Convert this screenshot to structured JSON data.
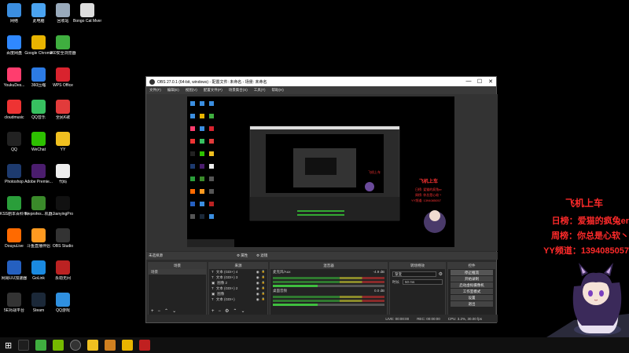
{
  "desktop": {
    "icons": [
      {
        "label": "网络",
        "color": "#3b8ee0",
        "col": 0,
        "row": 0
      },
      {
        "label": "此电脑",
        "color": "#4aa3f0",
        "col": 1,
        "row": 0
      },
      {
        "label": "回收站",
        "color": "#9ab",
        "col": 2,
        "row": 0
      },
      {
        "label": "Bongo Cat Mver",
        "color": "#ddd",
        "col": 3,
        "row": 0
      },
      {
        "label": "百度网盘",
        "color": "#2f88ff",
        "col": 0,
        "row": 1
      },
      {
        "label": "Google Chrome",
        "color": "#e8b400",
        "col": 1,
        "row": 1
      },
      {
        "label": "360安全浏览器",
        "color": "#3fae3f",
        "col": 2,
        "row": 1
      },
      {
        "label": "YoukuDes...",
        "color": "#ff3d6e",
        "col": 0,
        "row": 2
      },
      {
        "label": "360压缩",
        "color": "#2c7be5",
        "col": 1,
        "row": 2
      },
      {
        "label": "WPS Office",
        "color": "#d9232e",
        "col": 2,
        "row": 2
      },
      {
        "label": "cloudmusic",
        "color": "#e33",
        "col": 0,
        "row": 3
      },
      {
        "label": "QQ音乐",
        "color": "#37c060",
        "col": 1,
        "row": 3
      },
      {
        "label": "全民K歌",
        "color": "#e23b3b",
        "col": 2,
        "row": 3
      },
      {
        "label": "QQ",
        "color": "#222",
        "col": 0,
        "row": 4
      },
      {
        "label": "WeChat",
        "color": "#2dc100",
        "col": 1,
        "row": 4
      },
      {
        "label": "YY",
        "color": "#f0c020",
        "col": 2,
        "row": 4
      },
      {
        "label": "Photoshop",
        "color": "#1d3a6e",
        "col": 0,
        "row": 5
      },
      {
        "label": "Adobe Premie...",
        "color": "#4b1d6e",
        "col": 1,
        "row": 5
      },
      {
        "label": "代码",
        "color": "#eee",
        "col": 2,
        "row": 5
      },
      {
        "label": "KSS剧本百科卡拉OK",
        "color": "#2a9e3a",
        "col": 0,
        "row": 6
      },
      {
        "label": "liveprofes...机器",
        "color": "#3a8a2a",
        "col": 1,
        "row": 6
      },
      {
        "label": "JianyingPro",
        "color": "#111",
        "col": 2,
        "row": 6
      },
      {
        "label": "DouyuLive",
        "color": "#ff6a00",
        "col": 0,
        "row": 7
      },
      {
        "label": "斗鱼直播伴侣",
        "color": "#ff9a20",
        "col": 1,
        "row": 7
      },
      {
        "label": "OBS Studio",
        "color": "#333",
        "col": 2,
        "row": 7
      },
      {
        "label": "网易UU加速器",
        "color": "#2560c0",
        "col": 0,
        "row": 8
      },
      {
        "label": "GoLink",
        "color": "#1a8ae0",
        "col": 1,
        "row": 8
      },
      {
        "label": "永劫无间",
        "color": "#b22",
        "col": 2,
        "row": 8
      },
      {
        "label": "5E对战平台",
        "color": "#333",
        "col": 0,
        "row": 9
      },
      {
        "label": "Steam",
        "color": "#1b2838",
        "col": 1,
        "row": 9
      },
      {
        "label": "QQ游戏",
        "color": "#2f90e0",
        "col": 2,
        "row": 9
      }
    ]
  },
  "obs": {
    "title": "OBS 27.0.1 (64-bit, windows) - 配置文件: 未命名 - 场景: 未命名",
    "window_controls": [
      "—",
      "☐",
      "✕"
    ],
    "menu": [
      "文件(F)",
      "编辑(E)",
      "视图(V)",
      "配置文件(P)",
      "场景集合(S)",
      "工具(T)",
      "帮助(H)"
    ],
    "scene_header": "未选择源",
    "properties_button": "属性",
    "filters_button": "滤镜",
    "docks": {
      "scenes": {
        "title": "场景",
        "items": [
          "场景"
        ]
      },
      "sources": {
        "title": "来源",
        "items": [
          "文本 (GDI+) 4",
          "文本 (GDI+) 3",
          "图像 2",
          "文本 (GDI+) 2",
          "图像",
          "文本 (GDI+)"
        ]
      },
      "mixer": {
        "title": "混音器",
        "channels": [
          {
            "name": "麦克风/Aux",
            "db": "-4.9 dB"
          },
          {
            "name": "桌面音频",
            "db": "0.0 dB"
          }
        ]
      },
      "transitions": {
        "title": "转场特效",
        "type": "渐变",
        "duration_label": "时长",
        "duration": "50 ms"
      },
      "controls": {
        "title": "控件",
        "buttons": [
          "停止推流",
          "开始录制",
          "启动虚拟摄像机",
          "工作室模式",
          "设置",
          "退出"
        ]
      }
    },
    "status": {
      "live": "LIVE: 00:00:00",
      "rec": "REC: 00:00:00",
      "cpu": "CPU: 3.2%, 30.00 fps"
    }
  },
  "overlay": {
    "title": "飞机上车",
    "lines": [
      "日榜：爱猫的疯兔er",
      "周榜：你总是心软丶",
      "YY频道：1394085057"
    ]
  },
  "taskbar": {
    "items": [
      "start",
      "search",
      "taskview",
      "chrome",
      "nvidia",
      "obs",
      "yy",
      "app1",
      "app2"
    ]
  }
}
